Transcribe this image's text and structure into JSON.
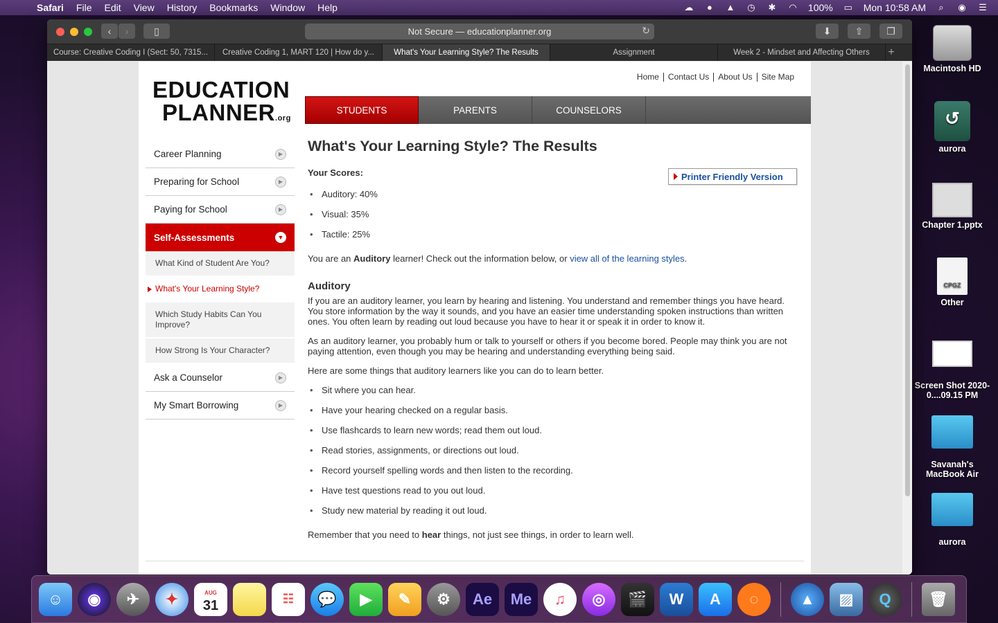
{
  "menubar": {
    "app": "Safari",
    "items": [
      "File",
      "Edit",
      "View",
      "History",
      "Bookmarks",
      "Window",
      "Help"
    ],
    "battery": "100%",
    "clock": "Mon 10:58 AM"
  },
  "browser": {
    "address": "Not Secure — educationplanner.org",
    "tabs": [
      "Course: Creative Coding I (Sect: 50, 7315...",
      "Creative Coding 1, MART 120 | How do y...",
      "What's Your Learning Style? The Results",
      "Assignment",
      "Week 2 - Mindset and Affecting Others"
    ],
    "active_tab": 2
  },
  "site": {
    "logo_line1": "EDUCATION",
    "logo_line2": "PLANNER",
    "logo_suffix": ".org",
    "toplinks": [
      "Home",
      "Contact Us",
      "About Us",
      "Site Map"
    ],
    "mainnav": [
      "STUDENTS",
      "PARENTS",
      "COUNSELORS"
    ],
    "leftnav": {
      "career": "Career Planning",
      "preparing": "Preparing for School",
      "paying": "Paying for School",
      "self": "Self-Assessments",
      "sub": [
        "What Kind of Student Are You?",
        "What's Your Learning Style?",
        "Which Study Habits Can You Improve?",
        "How Strong Is Your Character?"
      ],
      "counselor": "Ask a Counselor",
      "borrowing": "My Smart Borrowing"
    }
  },
  "main": {
    "title": "What's Your Learning Style? The Results",
    "scores_label": "Your Scores:",
    "printer": "Printer Friendly Version",
    "scores": [
      "Auditory: 40%",
      "Visual: 35%",
      "Tactile: 25%"
    ],
    "result_pre": "You are an ",
    "result_bold": "Auditory",
    "result_mid": " learner! Check out the information below, or ",
    "result_link": "view all of the learning styles",
    "result_end": ".",
    "section_title": "Auditory",
    "p1": "If you are an auditory learner, you learn by hearing and listening. You understand and remember things you have heard. You store information by the way it sounds, and you have an easier time understanding spoken instructions than written ones. You often learn by reading out loud because you have to hear it or speak it in order to know it.",
    "p2": "As an auditory learner, you probably hum or talk to yourself or others if you become bored. People may think you are not paying attention, even though you may be hearing and understanding everything being said.",
    "p3": "Here are some things that auditory learners like you can do to learn better.",
    "tips": [
      "Sit where you can hear.",
      "Have your hearing checked on a regular basis.",
      "Use flashcards to learn new words; read them out loud.",
      "Read stories, assignments, or directions out loud.",
      "Record yourself spelling words and then listen to the recording.",
      "Have test questions read to you out loud.",
      "Study new material by reading it out loud."
    ],
    "closing_pre": "Remember that you need to ",
    "closing_bold": "hear",
    "closing_post": " things, not just see things, in order to learn well."
  },
  "desktop": {
    "icons": [
      "Macintosh HD",
      "aurora",
      "Chapter 1.pptx",
      "Other",
      "Screen Shot 2020-0....09.15 PM",
      "Savanah's MacBook Air",
      "aurora"
    ],
    "cpgz_label": "CPGZ"
  },
  "dock": {
    "calendar_month": "AUG",
    "calendar_day": "31",
    "ae": "Ae",
    "me": "Me"
  }
}
